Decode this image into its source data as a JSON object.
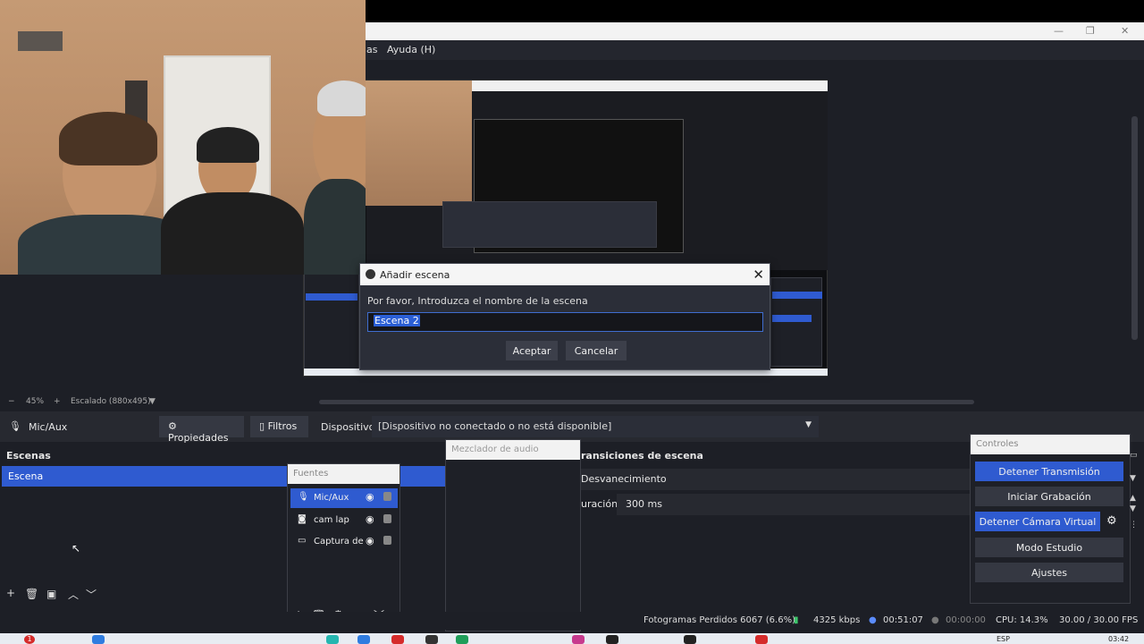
{
  "menubar": {
    "fragment": "as",
    "help": "Ayuda (H)"
  },
  "window_controls": {
    "minimize": "—",
    "maximize": "❐",
    "close": "✕"
  },
  "dialog": {
    "title": "Añadir escena",
    "prompt": "Por favor, Introduzca el nombre de la escena",
    "value": "Escena 2",
    "accept": "Aceptar",
    "cancel": "Cancelar",
    "close": "✕"
  },
  "zoom": {
    "minus": "−",
    "level": "45%",
    "plus": "+",
    "scale": "Escalado (880x495)",
    "caret": "▼"
  },
  "source_toolbar": {
    "source_name": "Mic/Aux",
    "properties": "Propiedades",
    "filters": "Filtros",
    "device_label": "Dispositivo",
    "device_value": "[Dispositivo no conectado o no está disponible]"
  },
  "scenes": {
    "title": "Escenas",
    "items": [
      "Escena"
    ]
  },
  "sources": {
    "title": "Fuentes",
    "items": [
      {
        "name": "Mic/Aux",
        "icon": "microphone-icon"
      },
      {
        "name": "cam lap",
        "icon": "camera-icon"
      },
      {
        "name": "Captura de",
        "icon": "monitor-icon"
      }
    ]
  },
  "mixer": {
    "title": "Mezclador de audio"
  },
  "transitions": {
    "title": "ransiciones de escena",
    "type": "Desvanecimiento",
    "duration_label": "uración",
    "duration_value": "300 ms"
  },
  "controls": {
    "title": "Controles",
    "stop_stream": "Detener Transmisión",
    "start_record": "Iniciar Grabación",
    "stop_virtualcam": "Detener Cámara Virtual",
    "studio_mode": "Modo Estudio",
    "settings": "Ajustes"
  },
  "status": {
    "dropped": "Fotogramas Perdidos 6067 (6.6%)",
    "bitrate": "4325 kbps",
    "stream_time": "00:51:07",
    "record_time": "00:00:00",
    "cpu": "CPU: 14.3%",
    "fps": "30.00 / 30.00 FPS"
  },
  "taskbar": {
    "lang": "ESP",
    "clock": "03:42",
    "badge": "1"
  },
  "colors": {
    "accent": "#2f5bd0",
    "bg": "#1d1f26",
    "panel": "#272930"
  }
}
